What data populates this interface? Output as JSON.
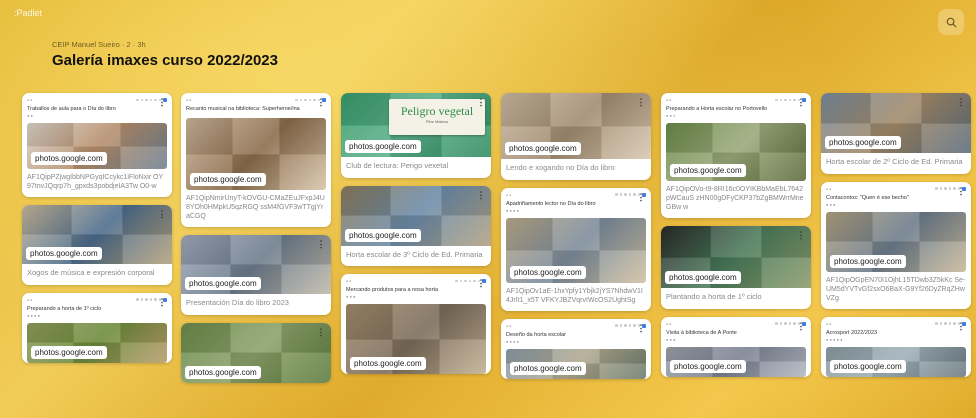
{
  "app": {
    "name": ":Padlet"
  },
  "header": {
    "meta": "CEIP Manuel Sueiro · 2 · 3h",
    "title": "Galería imaxes curso 2022/2023"
  },
  "link_label": "photos.google.com",
  "columns": [
    [
      {
        "title": "Traballos de aula para o Día do libro",
        "sub": "● ●",
        "photo": [
          "#d9d2c8",
          "#b58d6a",
          "#6c7f91"
        ],
        "code": "AF1QipPZjwgIbbNPGyqICcykc1iFloNxir OY97tnvJQqrp7h_gpxds3pobdjeIA3Tw O0-w"
      },
      {
        "photo": [
          "#c7b79a",
          "#4a6a8a",
          "#b5a07a"
        ],
        "caption": "Xogos de música e expresión corporal"
      },
      {
        "title": "Preparando a horta de 1º ciclo",
        "sub": "● ● ● ●",
        "photo": [
          "#8f9a5a",
          "#6b8a3a",
          "#b79a6a"
        ]
      }
    ],
    [
      {
        "title": "Recanto musical na biblioteca: Superheroe/ina",
        "sub": "",
        "photo": [
          "#c9b49a",
          "#8a6a4a",
          "#d6c4a8"
        ],
        "code": "AF1QipNmirUnyT-kOVGU-CMaZEuJFxpJ4U8YOh0HMpkU5qzRGQ ssM4fGVF3wTTgjYraCGQ"
      },
      {
        "photo": [
          "#a0a8b8",
          "#6a7a8a",
          "#c0b8a8"
        ],
        "caption": "Presentación Día do libro 2023"
      },
      {
        "photo": [
          "#6a8a4a",
          "#8aa06a",
          "#5a7a3a"
        ]
      }
    ],
    [
      {
        "photo": [
          "#3b9a6b",
          "#5ab08a",
          "#2f8a5e"
        ],
        "caption": "Club de lectura: Perigo vexetal",
        "book": {
          "title": "Peligro vegetal",
          "author": "Pilar Mateos"
        }
      },
      {
        "photo": [
          "#8a7a5a",
          "#6a8aa8",
          "#b0a080"
        ],
        "caption": "Horta escolar de 3º Ciclo de Ed. Primaria"
      },
      {
        "title": "Mercando produtos para a nosa horta",
        "sub": "● ● ●",
        "photo": [
          "#a08a6a",
          "#7a6a5a",
          "#c0b090"
        ]
      }
    ],
    [
      {
        "photo": [
          "#c8b8a0",
          "#a08a70",
          "#d8c8b0"
        ],
        "caption": "Lendo e xogando no Día do libro"
      },
      {
        "title": "Apadriñamento lector no Día do libro",
        "sub": "● ● ● ●",
        "photo": [
          "#b8a888",
          "#7a8a9a",
          "#d0c0a0"
        ],
        "code": "AF1QipOv1aE-1hxYpfy1Ybjk2jYS7NhdwV1I4JrIt1_x5T VFKYJBZVqrvIWcOS2UghtSg"
      },
      {
        "title": "Deseño da horta escolar",
        "sub": "● ● ● ●",
        "photo": [
          "#8a9aa8",
          "#b0a890",
          "#6a7a6a"
        ]
      }
    ],
    [
      {
        "title": "Preparando a Horta escolar no Portovello",
        "sub": "● ● 3",
        "photo": [
          "#6a8a4a",
          "#9aa87a",
          "#5a6a3a"
        ],
        "code": "AF1QipOVo-t9-8RI16c0OYIKBbMaEbL7642pWCauS zHN00gDFyCKP37bZgBMWrrMneGBw w"
      },
      {
        "photo": [
          "#2a2a2a",
          "#4a7a5a",
          "#8a9a6a"
        ],
        "caption": "Plantando a horta de 1º ciclo"
      },
      {
        "title": "Visita á biblioteca de A Ponte",
        "sub": "● ● ●",
        "photo": [
          "#9aa0a8",
          "#7a8090",
          "#b0b8c0"
        ]
      }
    ],
    [
      {
        "photo": [
          "#7a8a9a",
          "#a08868",
          "#5a6a7a"
        ],
        "caption": "Horta escolar de 2º Ciclo de Ed. Primaria"
      },
      {
        "title": "Contacontos: \"Quen é ese becho\"",
        "sub": "● ● ●",
        "photo": [
          "#b0a080",
          "#6a7a8a",
          "#c8b898"
        ],
        "code": "AF1QipOGpEN70I1OjhL15TDwb3Z5kKc Se-UM5dYVTvGf2sxO6BaX-G9Yf26DyZRqZHwVZg"
      },
      {
        "title": "Acrosport 2022/2023",
        "sub": "● ● ● ● ●",
        "photo": [
          "#8a9aa0",
          "#a0b0b8",
          "#6a7a80"
        ]
      }
    ]
  ]
}
